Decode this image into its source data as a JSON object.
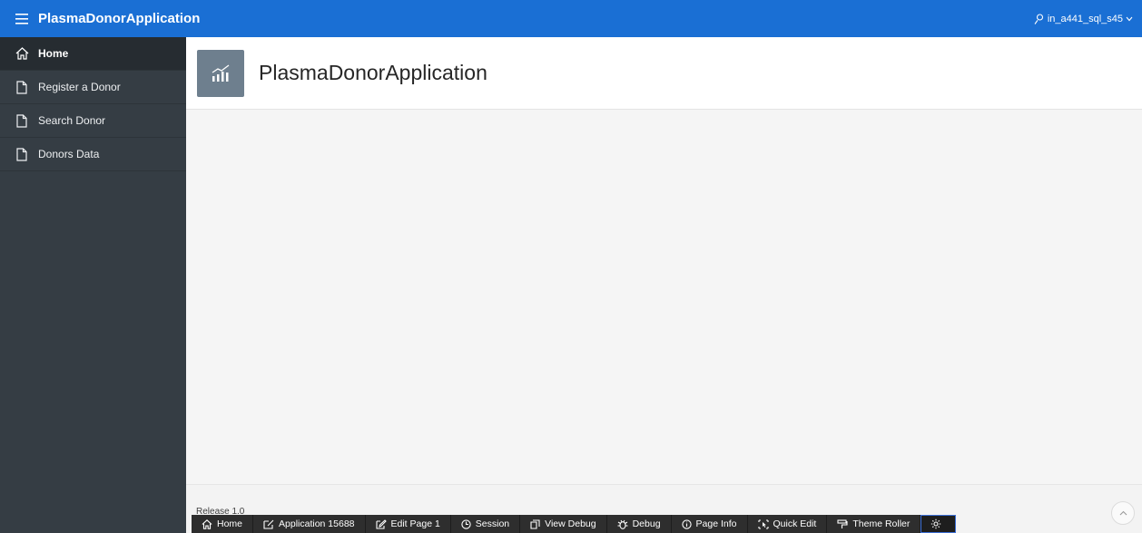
{
  "header": {
    "app_title": "PlasmaDonorApplication",
    "user_name": "in_a441_sql_s45",
    "menu_icon": "hamburger-icon",
    "user_icon": "user-icon",
    "accent_color": "#1a6fd4"
  },
  "sidebar": {
    "items": [
      {
        "label": "Home",
        "icon": "home-icon",
        "active": true
      },
      {
        "label": "Register a Donor",
        "icon": "page-icon"
      },
      {
        "label": "Search Donor",
        "icon": "page-icon"
      },
      {
        "label": "Donors Data",
        "icon": "page-icon"
      }
    ]
  },
  "main": {
    "page_title": "PlasmaDonorApplication",
    "hero_icon": "chart-icon",
    "release": "Release 1.0"
  },
  "devbar": {
    "items": [
      {
        "label": "Home",
        "icon": "home-icon"
      },
      {
        "label": "Application 15688",
        "icon": "edit-app-icon"
      },
      {
        "label": "Edit Page 1",
        "icon": "edit-page-icon"
      },
      {
        "label": "Session",
        "icon": "clock-icon"
      },
      {
        "label": "View Debug",
        "icon": "view-debug-icon"
      },
      {
        "label": "Debug",
        "icon": "bug-icon"
      },
      {
        "label": "Page Info",
        "icon": "info-icon"
      },
      {
        "label": "Quick Edit",
        "icon": "quick-edit-icon"
      },
      {
        "label": "Theme Roller",
        "icon": "paint-roller-icon"
      }
    ],
    "settings_icon": "gear-icon"
  }
}
